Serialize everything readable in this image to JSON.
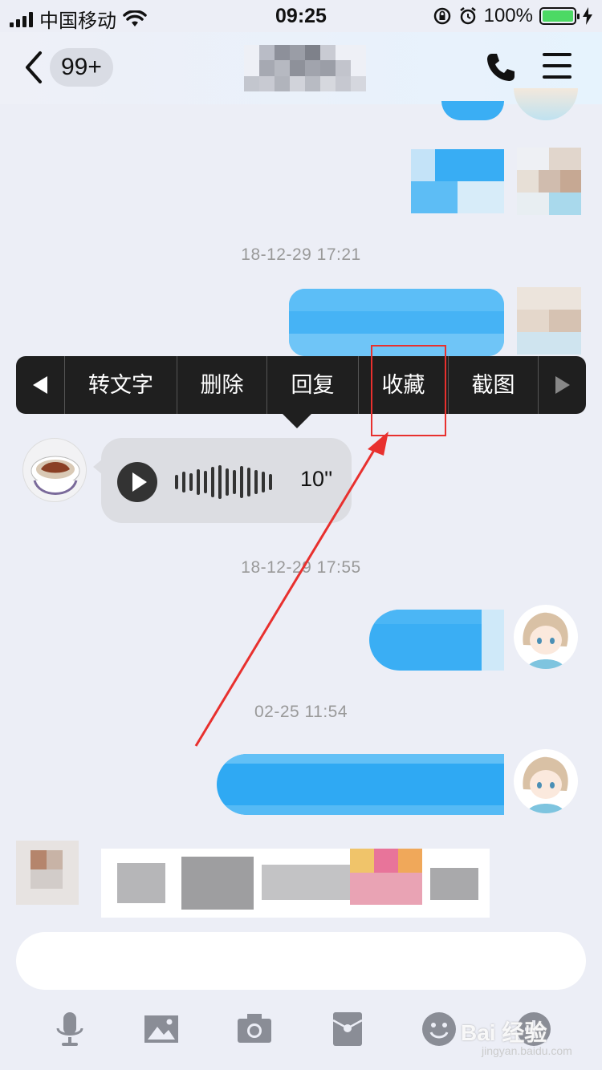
{
  "status_bar": {
    "carrier": "中国移动",
    "time": "09:25",
    "battery": "100%",
    "battery_level": 1.0
  },
  "nav": {
    "unread_badge": "99+",
    "back_icon": "chevron-left-icon",
    "call_icon": "phone-icon",
    "menu_icon": "hamburger-menu-icon"
  },
  "timestamps": {
    "t1": "18-12-29 17:21",
    "t2": "18-12-29 17:55",
    "t3": "02-25 11:54"
  },
  "context_menu": {
    "items": [
      "转文字",
      "删除",
      "回复",
      "收藏",
      "截图"
    ],
    "prev_icon": "triangle-left-icon",
    "next_icon": "triangle-right-icon"
  },
  "voice_message": {
    "duration": "10''",
    "play_icon": "play-icon"
  },
  "toolbar": {
    "icons": [
      "microphone-icon",
      "image-icon",
      "camera-icon",
      "red-packet-icon",
      "emoji-icon"
    ]
  },
  "watermark": {
    "brand": "Bai 经验",
    "url": "jingyan.baidu.com"
  },
  "colors": {
    "bubble_blue": "#3aaef4",
    "annotation_red": "#e8302e",
    "menu_bg": "#1f1f1f"
  }
}
